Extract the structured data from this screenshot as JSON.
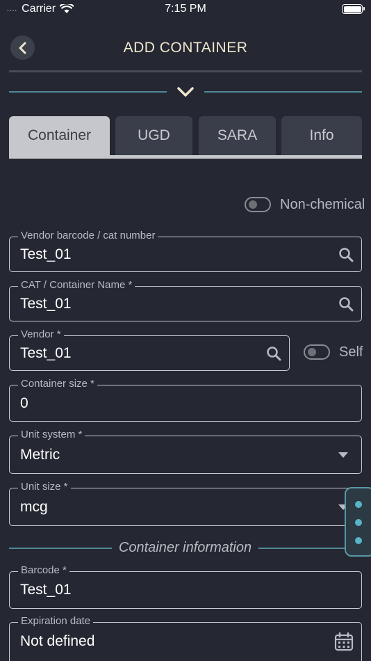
{
  "status_bar": {
    "carrier": "Carrier",
    "time": "7:15 PM"
  },
  "header": {
    "title": "ADD CONTAINER"
  },
  "tabs": [
    {
      "label": "Container",
      "active": true
    },
    {
      "label": "UGD",
      "active": false
    },
    {
      "label": "SARA",
      "active": false
    },
    {
      "label": "Info",
      "active": false
    }
  ],
  "non_chemical": {
    "label": "Non-chemical",
    "on": false
  },
  "fields": {
    "vendor_barcode": {
      "label": "Vendor barcode / cat number",
      "value": "Test_01",
      "icon": "search-icon"
    },
    "cat_name": {
      "label": "CAT / Container Name *",
      "value": "Test_01",
      "icon": "search-icon"
    },
    "vendor": {
      "label": "Vendor *",
      "value": "Test_01",
      "icon": "search-icon"
    },
    "self_toggle": {
      "label": "Self",
      "on": false
    },
    "container_size": {
      "label": "Container size *",
      "value": "0"
    },
    "unit_system": {
      "label": "Unit system *",
      "value": "Metric",
      "icon": "dropdown-caret-icon"
    },
    "unit_size": {
      "label": "Unit size *",
      "value": "mcg",
      "icon": "dropdown-caret-icon"
    },
    "barcode": {
      "label": "Barcode *",
      "value": "Test_01"
    },
    "expiration": {
      "label": "Expiration date",
      "value": "Not defined",
      "icon": "calendar-icon"
    }
  },
  "section": {
    "container_info": "Container information"
  },
  "colors": {
    "background": "#252832",
    "accent_teal": "#4f8a96",
    "title": "#efe6cf",
    "fab_dot": "#5ab4c8"
  }
}
